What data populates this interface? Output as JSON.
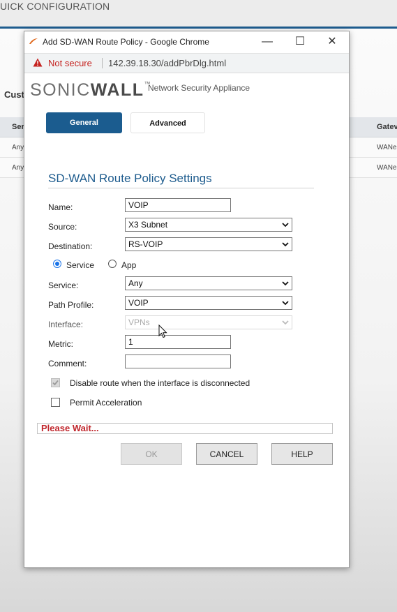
{
  "background_app": {
    "header_title": "UICK CONFIGURATION",
    "section_label": "Cust",
    "table": {
      "headers": [
        "Ser",
        "Gatev"
      ],
      "rows": [
        {
          "col1": "Any",
          "col2": "WANe"
        },
        {
          "col1": "Any",
          "col2": "WANe"
        }
      ]
    }
  },
  "window": {
    "title": "Add SD-WAN Route Policy - Google Chrome",
    "controls": {
      "minimize": "—",
      "maximize": "☐",
      "close": "✕"
    },
    "address_bar": {
      "security_label": "Not secure",
      "url": "142.39.18.30/addPbrDlg.html"
    }
  },
  "brand": {
    "logo_part1": "SONIC",
    "logo_part2": "WALL",
    "logo_tm": "™",
    "subtitle": "Network Security Appliance"
  },
  "tabs": [
    {
      "label": "General",
      "active": true
    },
    {
      "label": "Advanced",
      "active": false
    }
  ],
  "form": {
    "section_title": "SD-WAN Route Policy Settings",
    "name": {
      "label": "Name:",
      "value": "VOIP"
    },
    "source": {
      "label": "Source:",
      "value": "X3 Subnet"
    },
    "destination": {
      "label": "Destination:",
      "value": "RS-VOIP"
    },
    "mode_radio": {
      "service_label": "Service",
      "app_label": "App",
      "selected": "Service"
    },
    "service": {
      "label": "Service:",
      "value": "Any"
    },
    "path_profile": {
      "label": "Path Profile:",
      "value": "VOIP"
    },
    "interface": {
      "label": "Interface:",
      "value": "VPNs",
      "disabled": true
    },
    "metric": {
      "label": "Metric:",
      "value": "1"
    },
    "comment": {
      "label": "Comment:",
      "value": ""
    },
    "disable_route": {
      "label": "Disable route when the interface is disconnected",
      "checked": true,
      "disabled": true
    },
    "permit_acceleration": {
      "label": "Permit Acceleration",
      "checked": false
    }
  },
  "status": {
    "text": "Please Wait..."
  },
  "buttons": {
    "ok": "OK",
    "cancel": "CANCEL",
    "help": "HELP"
  },
  "colors": {
    "accent": "#1b5c8f",
    "warning": "#c5221f",
    "status_text": "#c0262c"
  }
}
